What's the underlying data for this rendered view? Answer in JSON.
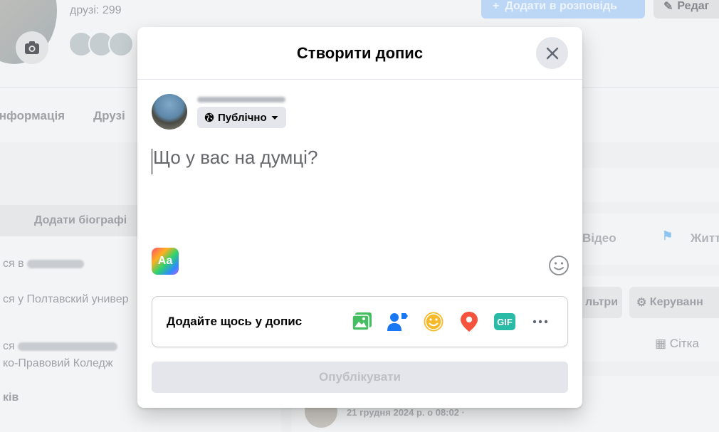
{
  "background": {
    "friends_label": "друзі: 299",
    "add_story_label": "Додати в розповідь",
    "edit_label": "Редаг",
    "tabs": [
      "інформація",
      "Друзі"
    ],
    "add_bio_label": "Додати біографі",
    "left_lines": [
      "ся в",
      "ся у Полтавский универ",
      "ся",
      "ко-Правовий Коледж",
      "ків"
    ],
    "right_video_label": "Відео",
    "right_life_label": "Житт",
    "filters_label": "льтри",
    "manage_label": "Керуванн",
    "grid_label": "Сітка",
    "post_date": "21 грудня 2024 р. о 08:02 ·"
  },
  "modal": {
    "title": "Створити допис",
    "audience": "Публічно",
    "composer_placeholder": "Що у вас на думці?",
    "text_format_label": "Aa",
    "add_to_post_label": "Додайте щось у допис",
    "add_to_post_icons": [
      "photo-video-icon",
      "tag-people-icon",
      "feeling-icon",
      "check-in-icon",
      "gif-icon",
      "more-icon"
    ],
    "gif_label": "GIF",
    "publish_label": "Опублікувати"
  },
  "colors": {
    "photo": "#45bd62",
    "tag": "#1877f2",
    "feeling": "#f7b928",
    "checkin": "#f5533d",
    "gif": "#2abba7"
  }
}
